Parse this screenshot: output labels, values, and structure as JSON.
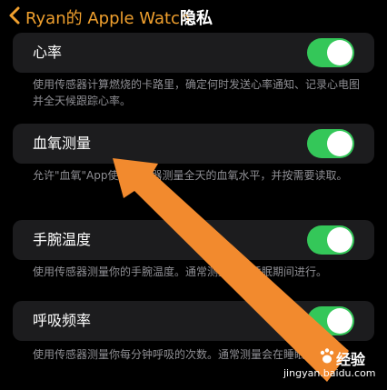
{
  "nav": {
    "back_label": "Ryan的 Apple Watch",
    "title": "隐私"
  },
  "settings": [
    {
      "label": "心率",
      "enabled": true,
      "description": "使用传感器计算燃烧的卡路里，确定何时发送心率通知、记录心电图并全天候跟踪心率。"
    },
    {
      "label": "血氧测量",
      "enabled": true,
      "description": "允许\"血氧\"App使用传感器测量全天的血氧水平，并按需要读取。"
    },
    {
      "label": "手腕温度",
      "enabled": true,
      "description": "使用传感器测量你的手腕温度。通常测量会在睡眠期间进行。"
    },
    {
      "label": "呼吸频率",
      "enabled": true,
      "description": "使用传感器测量你每分钟呼吸的次数。通常测量会在睡眠期间进行。"
    }
  ],
  "watermark": {
    "brand": "经验",
    "url": "jingyan.baidu.com"
  },
  "colors": {
    "accent": "#f0a02e",
    "toggle_on": "#34c759",
    "row_bg": "#1c1c1e",
    "arrow": "#f28a2e"
  }
}
